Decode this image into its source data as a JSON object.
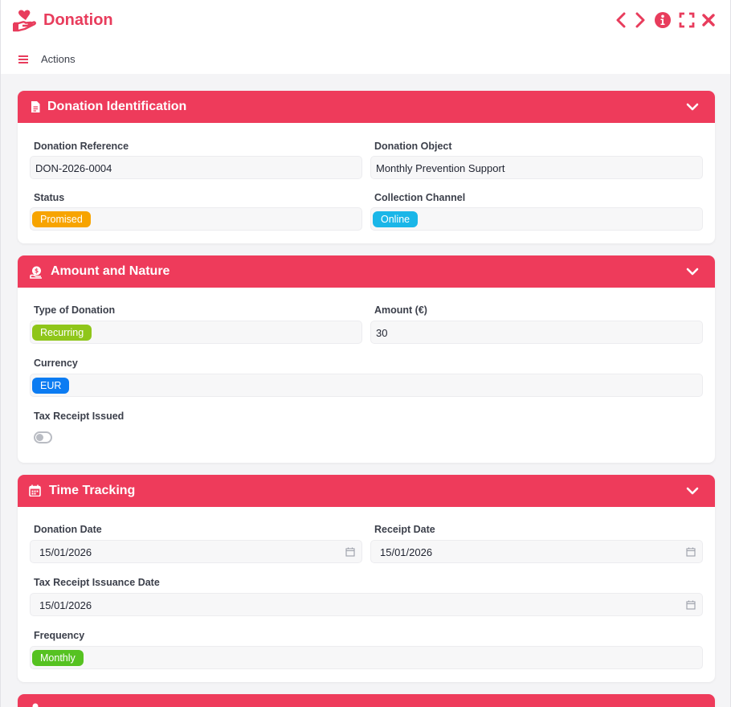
{
  "window": {
    "title": "Donation"
  },
  "menu": {
    "actions_label": "Actions"
  },
  "colors": {
    "accent": "#e83c5c",
    "header": "#ee3b5b",
    "status_promised": "#f7a400",
    "channel_online": "#1ab6e8",
    "type_recurring": "#8fc61a",
    "currency_eur": "#0c7cf2",
    "frequency_monthly": "#56c221"
  },
  "sections": {
    "identification": {
      "title": "Donation Identification",
      "fields": {
        "reference_label": "Donation Reference",
        "reference_value": "DON-2026-0004",
        "object_label": "Donation Object",
        "object_value": "Monthly Prevention Support",
        "status_label": "Status",
        "status_value": "Promised",
        "channel_label": "Collection Channel",
        "channel_value": "Online"
      }
    },
    "amount": {
      "title": "Amount and Nature",
      "fields": {
        "type_label": "Type of Donation",
        "type_value": "Recurring",
        "amount_label": "Amount (€)",
        "amount_value": "30",
        "currency_label": "Currency",
        "currency_value": "EUR",
        "tax_receipt_label": "Tax Receipt Issued",
        "tax_receipt_issued": false
      }
    },
    "time": {
      "title": "Time Tracking",
      "fields": {
        "donation_date_label": "Donation Date",
        "donation_date_value": "15/01/2026",
        "receipt_date_label": "Receipt Date",
        "receipt_date_value": "15/01/2026",
        "tax_date_label": "Tax Receipt Issuance Date",
        "tax_date_value": "15/01/2026",
        "frequency_label": "Frequency",
        "frequency_value": "Monthly"
      }
    }
  },
  "icons": {
    "app": "heart-hand-icon",
    "prev": "chevron-left-icon",
    "next": "chevron-right-icon",
    "info": "info-icon",
    "fullscreen": "fullscreen-icon",
    "close": "close-icon",
    "menu": "hamburger-icon",
    "identification": "document-icon",
    "amount": "money-bag-icon",
    "time": "calendar-icon"
  }
}
